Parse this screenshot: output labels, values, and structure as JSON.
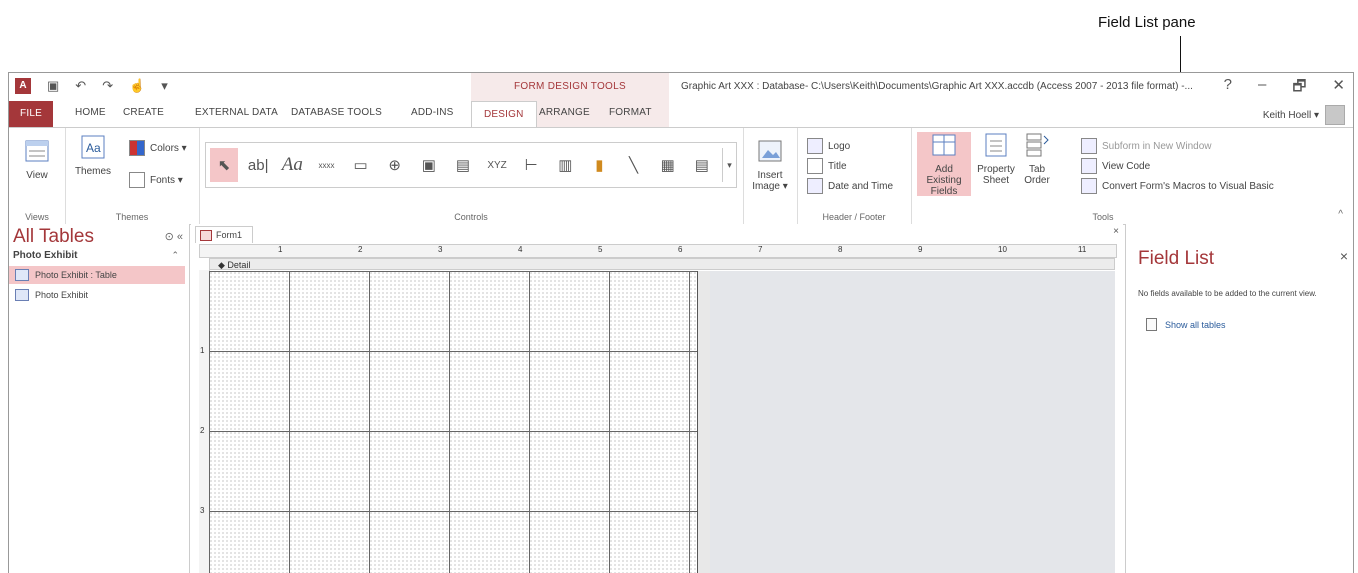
{
  "callout": "Field List pane",
  "titlebar": {
    "context_tab_group": "FORM DESIGN TOOLS",
    "doc_title": "Graphic Art XXX : Database- C:\\Users\\Keith\\Documents\\Graphic Art XXX.accdb (Access 2007 - 2013 file format) -...",
    "help": "?",
    "minimize": "–",
    "restore": "🗗",
    "close": "✕",
    "app_icon": "A"
  },
  "tabs": {
    "file": "FILE",
    "home": "HOME",
    "create": "CREATE",
    "external_data": "EXTERNAL DATA",
    "database_tools": "DATABASE TOOLS",
    "add_ins": "ADD-INS",
    "design": "DESIGN",
    "arrange": "ARRANGE",
    "format": "FORMAT",
    "user": "Keith Hoell ▾"
  },
  "ribbon": {
    "views": {
      "view": "View",
      "group": "Views"
    },
    "themes": {
      "themes": "Themes",
      "colors": "Colors ▾",
      "fonts": "Fonts ▾",
      "group": "Themes"
    },
    "controls": {
      "group": "Controls",
      "textbox": "ab|",
      "label": "Aa",
      "button": "xxxx",
      "option_group": "XYZ"
    },
    "insert_image": {
      "label": "Insert Image ▾"
    },
    "header_footer": {
      "logo": "Logo",
      "title": "Title",
      "date_time": "Date and Time",
      "group": "Header / Footer"
    },
    "tools": {
      "add_existing_fields": "Add Existing Fields",
      "property_sheet": "Property Sheet",
      "tab_order": "Tab Order",
      "subform": "Subform in New Window",
      "view_code": "View Code",
      "convert_macros": "Convert Form's Macros to Visual Basic",
      "group": "Tools",
      "collapse": "^"
    }
  },
  "nav": {
    "title": "All Tables",
    "buttons": "⊙ «",
    "group": "Photo Exhibit",
    "group_toggle": "⌃",
    "items": [
      "Photo Exhibit : Table",
      "Photo Exhibit"
    ]
  },
  "document": {
    "tab": "Form1",
    "close": "×",
    "section": "◆ Detail",
    "ruler_marks": [
      "1",
      "2",
      "3",
      "4",
      "5",
      "6",
      "7",
      "8",
      "9",
      "10",
      "11"
    ],
    "vruler_marks": [
      "1",
      "2",
      "3"
    ]
  },
  "field_list": {
    "title": "Field List",
    "close": "×",
    "message": "No fields available to be added to the current view.",
    "link": "Show all tables"
  }
}
